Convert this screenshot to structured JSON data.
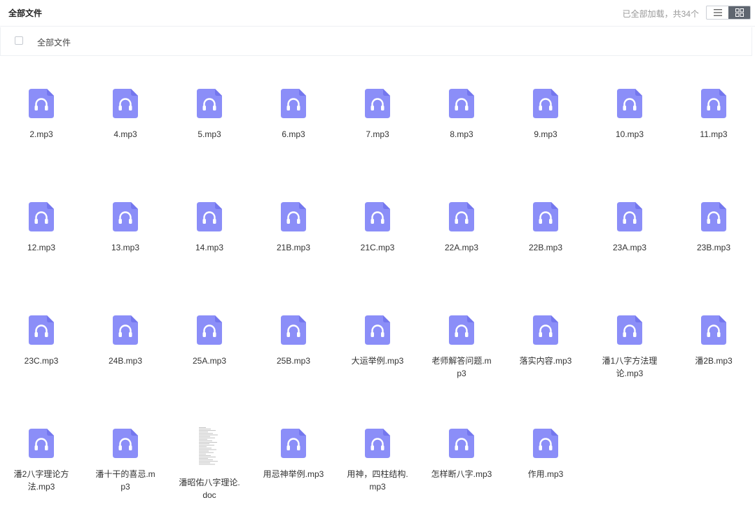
{
  "header": {
    "title": "全部文件",
    "status": "已全部加载，共34个"
  },
  "selection": {
    "label": "全部文件"
  },
  "files": [
    {
      "name": "2.mp3",
      "type": "audio"
    },
    {
      "name": "4.mp3",
      "type": "audio"
    },
    {
      "name": "5.mp3",
      "type": "audio"
    },
    {
      "name": "6.mp3",
      "type": "audio"
    },
    {
      "name": "7.mp3",
      "type": "audio"
    },
    {
      "name": "8.mp3",
      "type": "audio"
    },
    {
      "name": "9.mp3",
      "type": "audio"
    },
    {
      "name": "10.mp3",
      "type": "audio"
    },
    {
      "name": "11.mp3",
      "type": "audio"
    },
    {
      "name": "12.mp3",
      "type": "audio"
    },
    {
      "name": "13.mp3",
      "type": "audio"
    },
    {
      "name": "14.mp3",
      "type": "audio"
    },
    {
      "name": "21B.mp3",
      "type": "audio"
    },
    {
      "name": "21C.mp3",
      "type": "audio"
    },
    {
      "name": "22A.mp3",
      "type": "audio"
    },
    {
      "name": "22B.mp3",
      "type": "audio"
    },
    {
      "name": "23A.mp3",
      "type": "audio"
    },
    {
      "name": "23B.mp3",
      "type": "audio"
    },
    {
      "name": "23C.mp3",
      "type": "audio"
    },
    {
      "name": "24B.mp3",
      "type": "audio"
    },
    {
      "name": "25A.mp3",
      "type": "audio"
    },
    {
      "name": "25B.mp3",
      "type": "audio"
    },
    {
      "name": "大运举例.mp3",
      "type": "audio"
    },
    {
      "name": "老师解答问题.mp3",
      "type": "audio"
    },
    {
      "name": "落实内容.mp3",
      "type": "audio"
    },
    {
      "name": "潘1八字方法理论.mp3",
      "type": "audio"
    },
    {
      "name": "潘2B.mp3",
      "type": "audio"
    },
    {
      "name": "潘2八字理论方法.mp3",
      "type": "audio"
    },
    {
      "name": "潘十干的喜忌.mp3",
      "type": "audio"
    },
    {
      "name": "潘昭佑八字理论.doc",
      "type": "doc"
    },
    {
      "name": "用忌神举例.mp3",
      "type": "audio"
    },
    {
      "name": "用神，四柱结构.mp3",
      "type": "audio"
    },
    {
      "name": "怎样断八字.mp3",
      "type": "audio"
    },
    {
      "name": "作用.mp3",
      "type": "audio"
    }
  ],
  "colors": {
    "audio_icon": "#8b8ef8",
    "audio_icon_dark": "#7477ee",
    "active_view": "#5f6670"
  }
}
